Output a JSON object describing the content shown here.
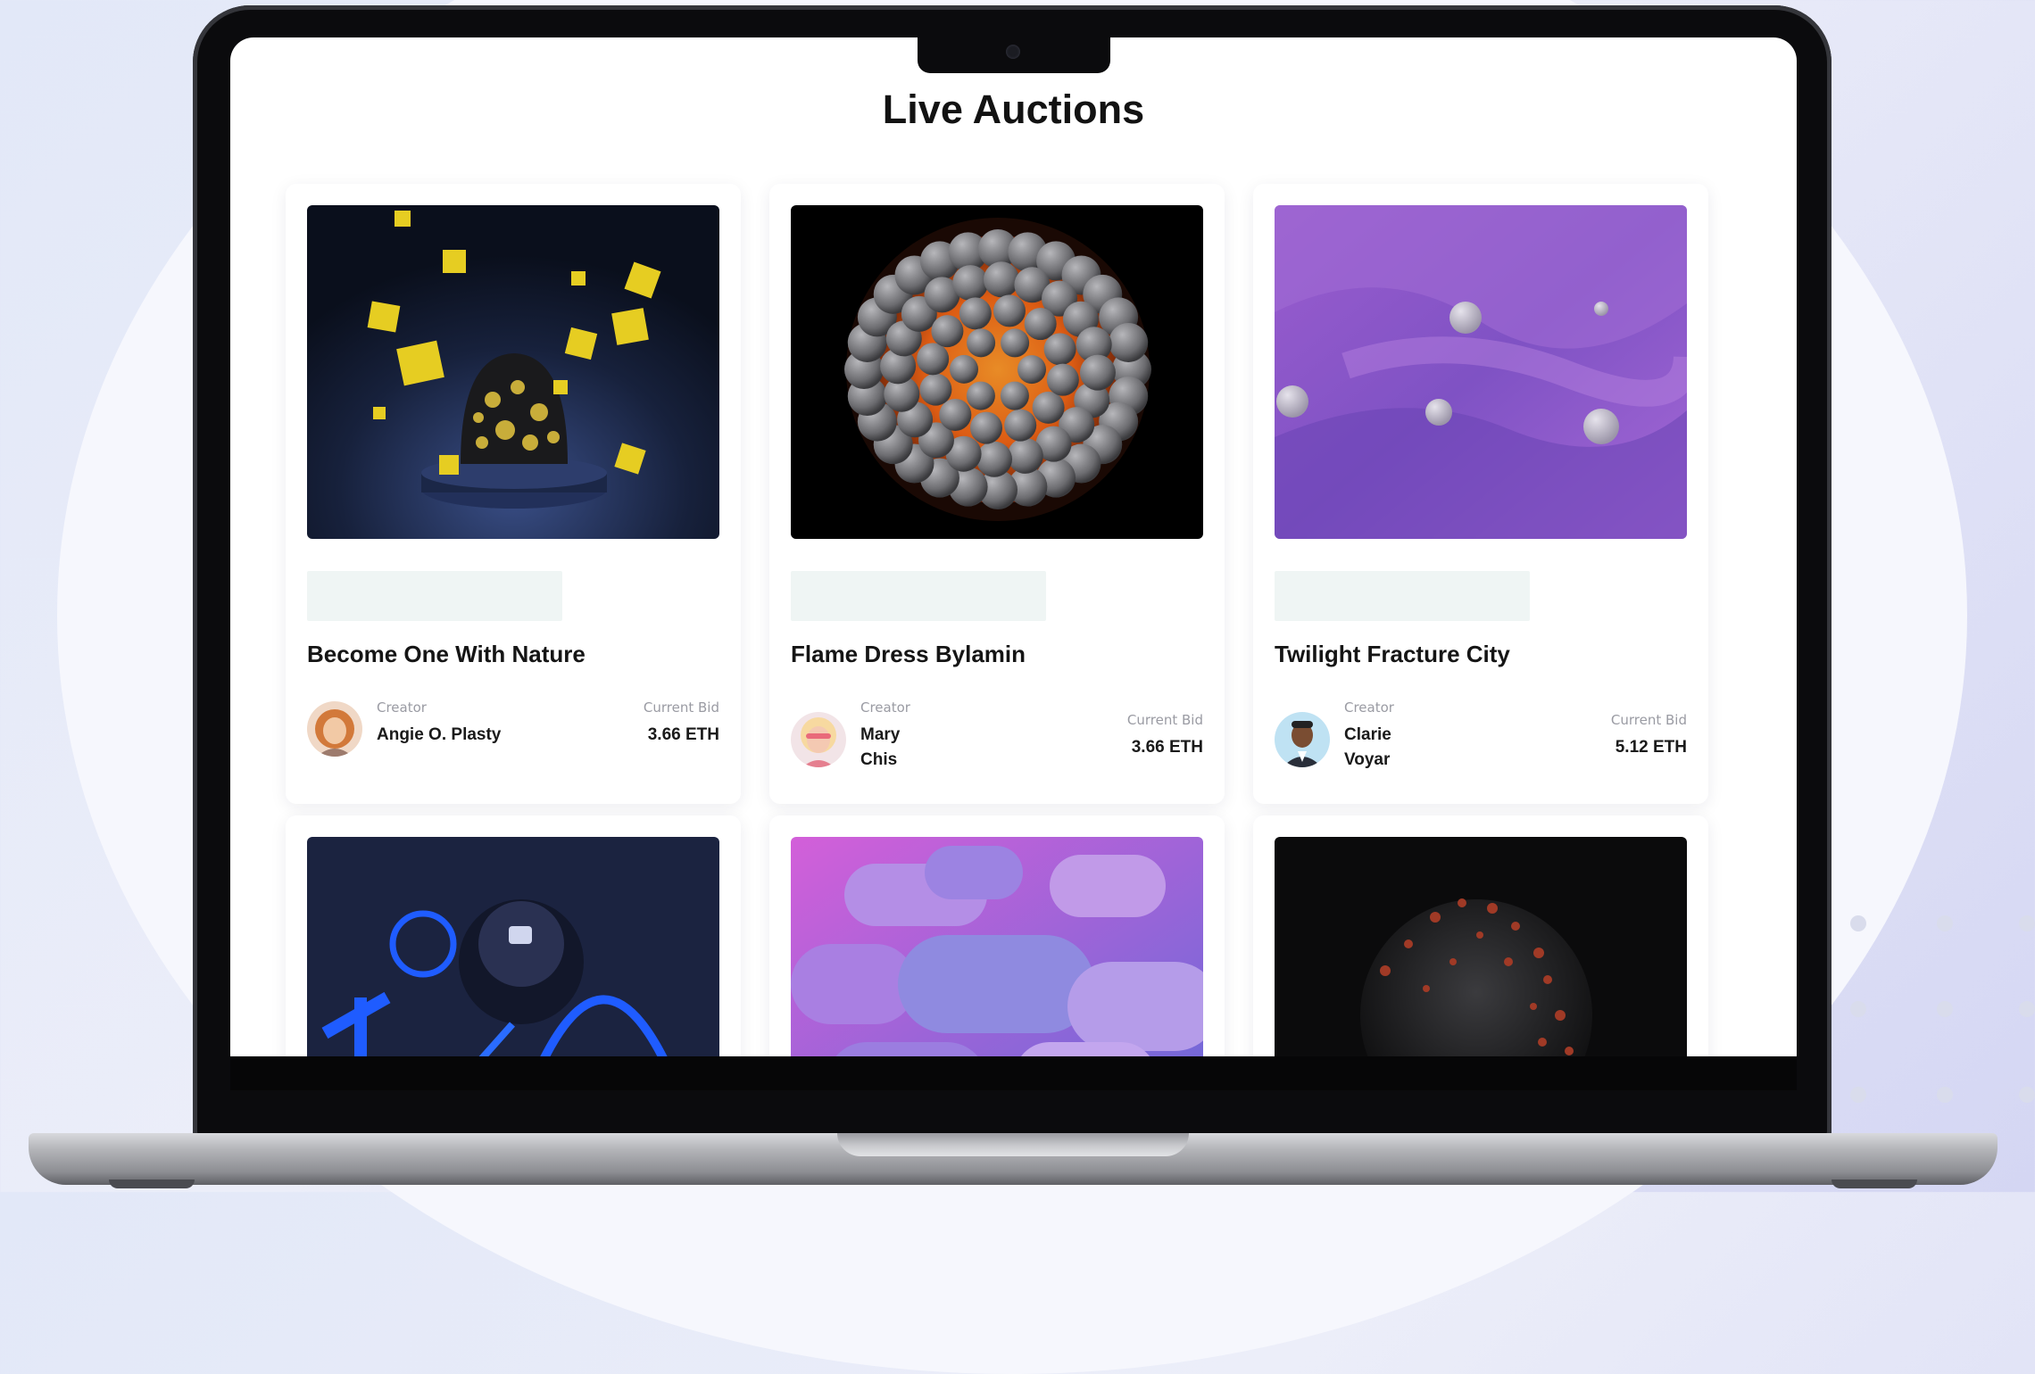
{
  "page": {
    "title": "Live Auctions"
  },
  "labels": {
    "creator": "Creator",
    "current_bid": "Current Bid"
  },
  "auctions": [
    {
      "title": "Become One With Nature",
      "creator": "Angie O. Plasty",
      "bid": "3.66 ETH",
      "image": "yellow-cubes-artwork"
    },
    {
      "title": "Flame Dress Bylamin",
      "creator": "Mary\nChis",
      "bid": "3.66 ETH",
      "image": "orange-sphere-artwork"
    },
    {
      "title": "Twilight Fracture City",
      "creator": "Clarie\nVoyar",
      "bid": "5.12 ETH",
      "image": "purple-landscape-artwork"
    }
  ],
  "auctions_row2": [
    {
      "image": "blue-neon-artwork"
    },
    {
      "image": "pink-blocks-artwork"
    },
    {
      "image": "dark-sphere-artwork"
    }
  ],
  "colors": {
    "accent": "#eff5f4",
    "title": "#121212",
    "muted": "#9a9ba3"
  }
}
